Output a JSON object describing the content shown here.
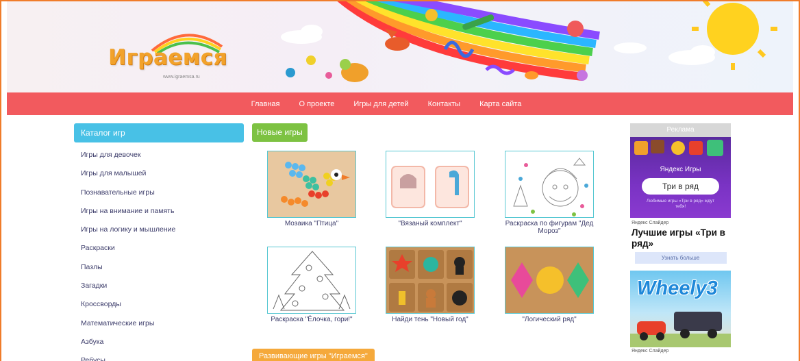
{
  "header": {
    "logo_text": "Играемся",
    "logo_url": "www.igraemsa.ru"
  },
  "nav": [
    {
      "label": "Главная"
    },
    {
      "label": "О проекте"
    },
    {
      "label": "Игры для детей"
    },
    {
      "label": "Контакты"
    },
    {
      "label": "Карта сайта"
    }
  ],
  "sidebar": {
    "title": "Каталог игр",
    "items": [
      "Игры для девочек",
      "Игры для малышей",
      "Познавательные игры",
      "Игры на внимание и память",
      "Игры на логику и мышление",
      "Раскраски",
      "Пазлы",
      "Загадки",
      "Кроссворды",
      "Математические игры",
      "Азбука",
      "Ребусы"
    ]
  },
  "main": {
    "new_games_title": "Новые игры",
    "games": [
      {
        "title": "Мозаика \"Птица\""
      },
      {
        "title": "\"Вязаный комплект\""
      },
      {
        "title": "Раскраска по фигурам \"Дед Мороз\""
      },
      {
        "title": "Раскраска \"Ёлочка, гори!\""
      },
      {
        "title": "Найди тень \"Новый год\""
      },
      {
        "title": "\"Логический ряд\""
      }
    ],
    "dev_games_title": "Развивающие игры \"Играемся\""
  },
  "ads": {
    "label": "Реклама",
    "ad1_brand": "Яндекс Игры",
    "ad1_button": "Три в ряд",
    "ad1_small": "Любимые игры «Три в ряд» ждут тебя!",
    "ad1_sponsor": "Яндекс Слайдер",
    "ad1_headline": "Лучшие игры «Три в ряд»",
    "ad1_more": "Узнать больше",
    "ad2_logo": "Wheely3",
    "ad2_sponsor": "Яндекс Слайдер"
  },
  "colors": {
    "nav_bg": "#f25a5e",
    "catalog_bg": "#48c1e6",
    "new_games_bg": "#7dc242",
    "dev_games_bg": "#f5a93b",
    "frame": "#f07c2a"
  }
}
